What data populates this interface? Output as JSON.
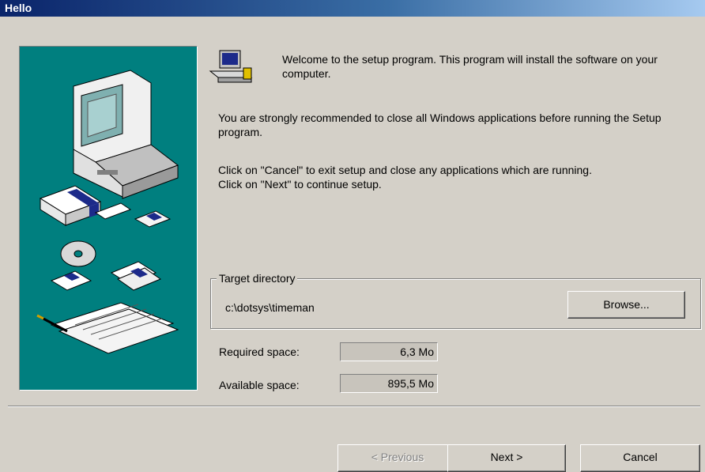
{
  "window": {
    "title": "Hello"
  },
  "intro": {
    "welcome": "Welcome to the setup program. This program will install the software on your computer.",
    "recommend": "You are strongly recommended to close all Windows applications before running the Setup program.",
    "cancel_hint": "Click on \"Cancel\" to exit setup and close any applications which are running.",
    "next_hint": "Click on \"Next\" to continue setup."
  },
  "target": {
    "group_label": "Target directory",
    "path": "c:\\dotsys\\timeman",
    "browse_label": "Browse..."
  },
  "space": {
    "required_label": "Required space:",
    "required_value": "6,3 Mo",
    "available_label": "Available space:",
    "available_value": "895,5 Mo"
  },
  "buttons": {
    "previous": "< Previous",
    "next": "Next >",
    "cancel": "Cancel"
  },
  "icons": [
    "setup-computer-icon",
    "installer-illustration"
  ]
}
